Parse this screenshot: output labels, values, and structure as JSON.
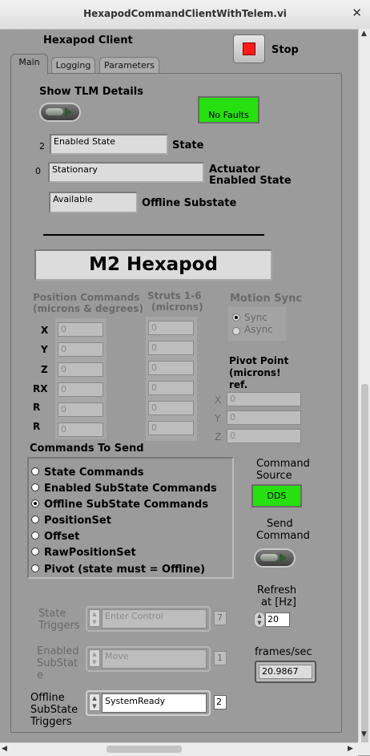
{
  "window": {
    "title": "HexapodCommandClientWithTelem.vi",
    "close_glyph": "✕"
  },
  "header": {
    "label": "Hexapod Client",
    "stop_label": "Stop"
  },
  "tabs": [
    {
      "label": "Main"
    },
    {
      "label": "Logging"
    },
    {
      "label": "Parameters"
    }
  ],
  "main": {
    "show_tlm_label": "Show TLM Details",
    "fault_indicator": "No Faults",
    "state": {
      "index": "2",
      "value": "Enabled State",
      "label": "State"
    },
    "actuator_state": {
      "index": "0",
      "value": "Stationary",
      "label_line1": "Actuator",
      "label_line2": "Enabled State"
    },
    "offline_substate": {
      "value": "Available",
      "label": "Offline Substate"
    },
    "device_title": "M2 Hexapod",
    "position_commands": {
      "header_line1": "Position Commands",
      "header_line2": "(microns & degrees)",
      "axes": [
        "X",
        "Y",
        "Z",
        "RX",
        "R",
        "R"
      ],
      "values": [
        "0",
        "0",
        "0",
        "0",
        "0",
        "0"
      ]
    },
    "struts": {
      "header_line1": "Struts 1-6",
      "header_line2": "(microns)",
      "values": [
        "0",
        "0",
        "0",
        "0",
        "0",
        "0"
      ]
    },
    "motion_sync": {
      "header": "Motion Sync",
      "options": [
        "Sync",
        "Async"
      ],
      "selected": "Sync"
    },
    "pivot_point": {
      "header_line1": "Pivot Point",
      "header_line2": "(microns!",
      "header_line3": "ref.",
      "axes": [
        "X",
        "Y",
        "Z"
      ],
      "values": [
        "0",
        "0",
        "0"
      ]
    },
    "commands_to_send": {
      "header": "Commands To Send",
      "options": [
        "State Commands",
        "Enabled SubState Commands",
        "Offline SubState Commands",
        "PositionSet",
        "Offset",
        "RawPositionSet",
        "Pivot (state must = Offline)"
      ],
      "selected": "Offline SubState Commands"
    },
    "command_source": {
      "label_line1": "Command",
      "label_line2": "Source",
      "value": "DDS"
    },
    "send_command": {
      "label_line1": "Send",
      "label_line2": "Command"
    },
    "refresh": {
      "label_line1": "Refresh",
      "label_line2": "at [Hz]",
      "value": "20"
    },
    "frames_per_sec": {
      "label": "frames/sec",
      "value": "20.9867"
    },
    "state_triggers": {
      "label_line1": "State",
      "label_line2": "Triggers",
      "value": "Enter Control",
      "index": "7"
    },
    "enabled_substate_triggers": {
      "label_line1": "Enabled",
      "label_line2": "SubStat",
      "label_line3": "e",
      "value": "Move",
      "index": "1"
    },
    "offline_substate_triggers": {
      "label_line1": "Offline",
      "label_line2": "SubState",
      "label_line3": "Triggers",
      "value": "SystemReady",
      "index": "2"
    }
  },
  "colors": {
    "panel": "#9b9b9b",
    "indicator_green": "#26e010",
    "stop_red": "#ff1a1a"
  }
}
